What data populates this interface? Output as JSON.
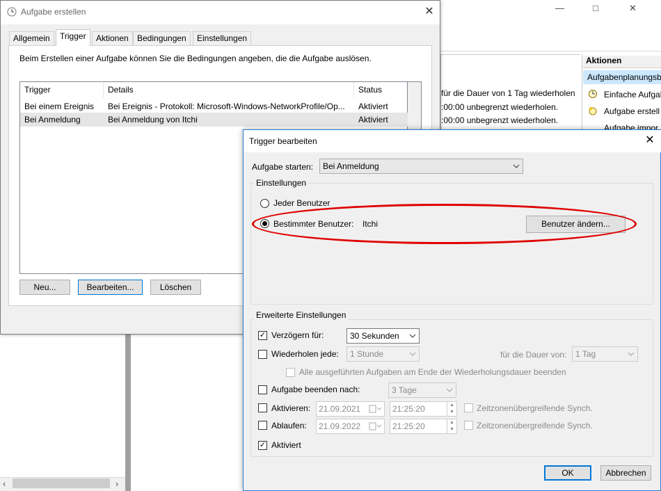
{
  "background_window": {
    "toolbar_controls": [
      "—",
      "□",
      "✕"
    ],
    "details_lines": [
      "für die Dauer von 1 Tag wiederholen",
      ":00:00 unbegrenzt wiederholen.",
      ":00:00 unbegrenzt wiederholen."
    ],
    "actions_header": "Aktionen",
    "actions_selected": "Aufgabenplanungsb",
    "actions_items": [
      "Einfache Aufgal",
      "Aufgabe erstell",
      "Aufgabe impor"
    ],
    "scroll_left_arrow": "‹",
    "scroll_right_arrow": "›"
  },
  "dialog_create": {
    "title": "Aufgabe erstellen",
    "close_glyph": "✕",
    "tabs": [
      {
        "label": "Allgemein",
        "active": false
      },
      {
        "label": "Trigger",
        "active": true
      },
      {
        "label": "Aktionen",
        "active": false
      },
      {
        "label": "Bedingungen",
        "active": false
      },
      {
        "label": "Einstellungen",
        "active": false
      }
    ],
    "description": "Beim Erstellen einer Aufgabe können Sie die Bedingungen angeben, die die Aufgabe auslösen.",
    "table": {
      "headers": [
        "Trigger",
        "Details",
        "Status"
      ],
      "rows": [
        [
          "Bei einem Ereignis",
          "Bei Ereignis - Protokoll: Microsoft-Windows-NetworkProfile/Op...",
          "Aktiviert"
        ],
        [
          "Bei Anmeldung",
          "Bei Anmeldung von Itchi",
          "Aktiviert"
        ]
      ]
    },
    "buttons": {
      "new": "Neu...",
      "edit": "Bearbeiten...",
      "delete": "Löschen"
    }
  },
  "dialog_trigger": {
    "title": "Trigger bearbeiten",
    "close_glyph": "✕",
    "start_label": "Aufgabe starten:",
    "start_value": "Bei Anmeldung",
    "settings_group": "Einstellungen",
    "radio_any_user": "Jeder Benutzer",
    "radio_specific_user": "Bestimmter Benutzer:",
    "user_name": "Itchi",
    "change_user_button": "Benutzer ändern...",
    "advanced_group": "Erweiterte Einstellungen",
    "delay": {
      "label": "Verzögern für:",
      "checked": true,
      "value": "30 Sekunden"
    },
    "repeat": {
      "label": "Wiederholen jede:",
      "checked": false,
      "value": "1 Stunde",
      "duration_label": "für die Dauer von:",
      "duration_value": "1 Tag"
    },
    "stop_all": {
      "label": "Alle ausgeführten Aufgaben am Ende der Wiederholungsdauer beenden",
      "checked": false
    },
    "stop_after": {
      "label": "Aufgabe beenden nach:",
      "checked": false,
      "value": "3 Tage"
    },
    "activate": {
      "label": "Aktivieren:",
      "checked": false,
      "date": "21.09.2021",
      "time": "21:25:20",
      "sync_label": "Zeitzonenübergreifende Synch."
    },
    "expire": {
      "label": "Ablaufen:",
      "checked": false,
      "date": "21.09.2022",
      "time": "21:25:20",
      "sync_label": "Zeitzonenübergreifende Synch."
    },
    "enabled": {
      "label": "Aktiviert",
      "checked": true
    },
    "ok_button": "OK",
    "cancel_button": "Abbrechen"
  },
  "colors": {
    "highlight_ellipse": "#e00000",
    "focus_blue": "#0078d7",
    "selection": "#cce8ff"
  }
}
